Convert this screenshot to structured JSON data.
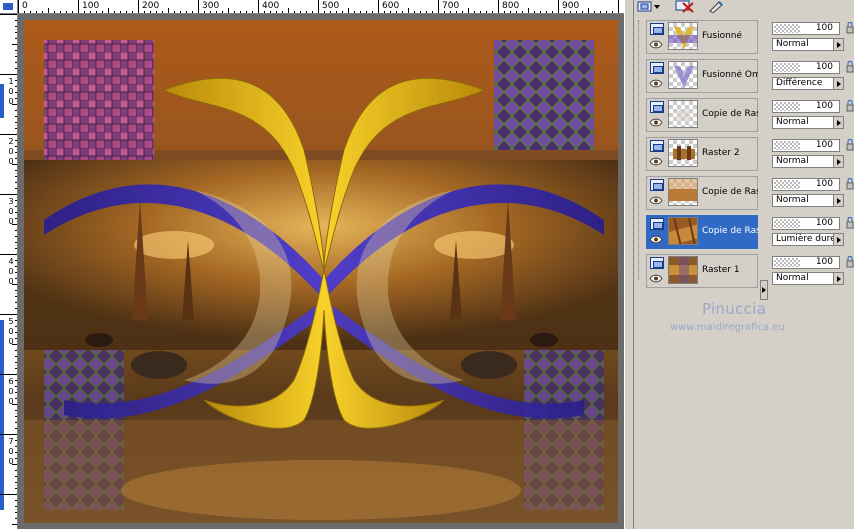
{
  "ruler_top": {
    "labels": [
      "0",
      "100",
      "200",
      "300",
      "400",
      "500",
      "600",
      "700",
      "800",
      "900"
    ]
  },
  "ruler_left": {
    "labels": [
      "1",
      "0",
      "0",
      "2",
      "0",
      "0",
      "3",
      "0",
      "0",
      "4",
      "0",
      "0",
      "5",
      "0",
      "0",
      "6",
      "0",
      "0",
      "7",
      "0",
      "0"
    ]
  },
  "layers": [
    {
      "name": "Fusionné",
      "selected": false
    },
    {
      "name": "Fusionné Oml",
      "selected": false
    },
    {
      "name": "Copie de Rast",
      "selected": false
    },
    {
      "name": "Raster 2",
      "selected": false
    },
    {
      "name": "Copie de Rast",
      "selected": false
    },
    {
      "name": "Copie de Rast",
      "selected": true
    },
    {
      "name": "Raster 1",
      "selected": false
    }
  ],
  "layer_props": [
    {
      "opacity": "100",
      "blend": "Normal"
    },
    {
      "opacity": "100",
      "blend": "Différence"
    },
    {
      "opacity": "100",
      "blend": "Normal"
    },
    {
      "opacity": "100",
      "blend": "Normal"
    },
    {
      "opacity": "100",
      "blend": "Normal"
    },
    {
      "opacity": "100",
      "blend": "Lumière dure"
    },
    {
      "opacity": "100",
      "blend": "Normal"
    }
  ],
  "watermark": {
    "title": "Pinuccia",
    "url": "www.maidiregrafica.eu"
  },
  "colors": {
    "selection": "#316ac5",
    "panel": "#d4d0c8",
    "ribbon_yellow": "#f2c61c",
    "ribbon_blue": "#3b2ab0"
  },
  "icons": [
    "new-layer-icon",
    "delete-layer-icon",
    "edit-mask-icon",
    "eye-icon",
    "layer-type-icon",
    "lock-icon"
  ]
}
